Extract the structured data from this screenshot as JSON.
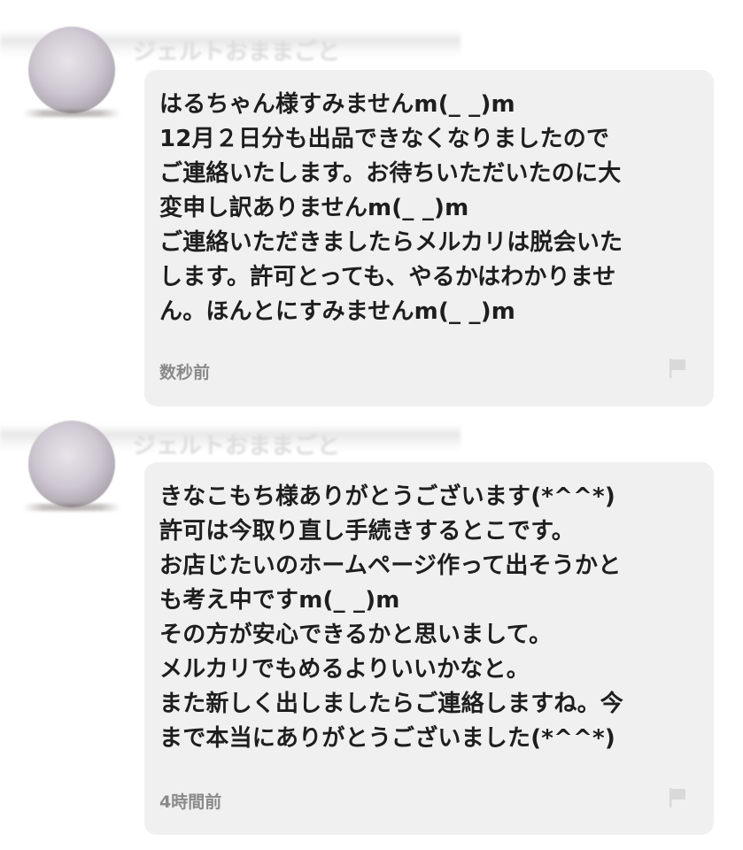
{
  "messages": [
    {
      "sender_name": "ジェルトおままごと",
      "text": "はるちゃん様すみませんm(_ _)m\n12月２日分も出品できなくなりましたので\nご連絡いたします。お待ちいただいたのに大\n変申し訳ありませんm(_ _)m\nご連絡いただきましたらメルカリは脱会いた\nします。許可とっても、やるかはわかりませ\nん。ほんとにすみませんm(_ _)m",
      "timestamp": "数秒前",
      "flag_icon": "flag-icon"
    },
    {
      "sender_name": "ジェルトおままごと",
      "text": "きなこもち様ありがとうございます(*^^*)\n許可は今取り直し手続きするとこです。\nお店じたいのホームページ作って出そうかと\nも考え中ですm(_ _)m\nその方が安心できるかと思いまして。\nメルカリでもめるよりいいかなと。\nまた新しく出しましたらご連絡しますね。今\nまで本当にありがとうございました(*^^*)",
      "timestamp": "4時間前",
      "flag_icon": "flag-icon"
    }
  ],
  "colors": {
    "bubble_bg": "#f0f0f0",
    "text": "#1e1e1e",
    "timestamp": "#8a8a8a",
    "flag": "#d9d9d9"
  }
}
